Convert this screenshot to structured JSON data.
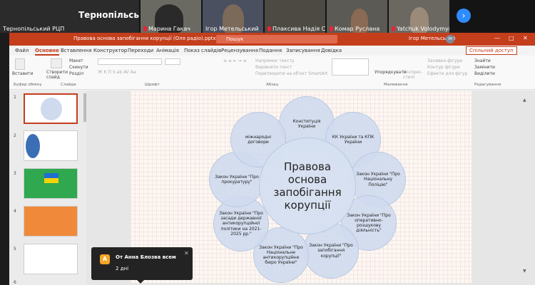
{
  "gallery": {
    "first_tile_name": "Тернопільський...",
    "tiles": [
      {
        "name": "Тернопільський РЦП",
        "muted": false
      },
      {
        "name": "Марина Гакач",
        "muted": true
      },
      {
        "name": "Ігор Метельський",
        "muted": false
      },
      {
        "name": "Плаксива Надія Степа...",
        "muted": true
      },
      {
        "name": "Комар Руслана",
        "muted": true
      },
      {
        "name": "Yatchuk Volodymyr",
        "muted": true
      }
    ],
    "next_icon": "chevron-right-icon"
  },
  "ppt": {
    "doc_title": "Правова основа запобігання корупції (Оля радіо).pptx  -  PowerPoint",
    "search_placeholder": "Пошук",
    "user_name": "Ігор Метельський",
    "user_initials": "ІМ",
    "tabs": [
      "Файл",
      "Основне",
      "Вставлення",
      "Конструктор",
      "Переходи",
      "Анімація",
      "Показ слайдів",
      "Рецензування",
      "Подання",
      "Записування",
      "Довідка"
    ],
    "share_label": "Спільний доступ",
    "ribbon": {
      "paste": "Вставити",
      "create_slide": "Створити слайд",
      "layout": "Макет",
      "reset": "Скинути",
      "section": "Розділ",
      "text_direction": "Напрямок тексту",
      "align_text": "Вирівняти текст",
      "smartart": "Перетворити на об'єкт SmartArt",
      "arrange": "Упорядкувати",
      "quick_styles": "Експрес-стилі",
      "fill": "Заливка фігури",
      "outline": "Контур фігури",
      "effects": "Ефекти для фігур",
      "find": "Знайти",
      "replace": "Замінити",
      "select": "Виділити",
      "groups": [
        "Буфер обміну",
        "Слайди",
        "Шрифт",
        "Абзац",
        "Малювання",
        "Редагування"
      ]
    },
    "slide_numbers": [
      "1",
      "2",
      "3",
      "4",
      "5",
      "6"
    ]
  },
  "slide": {
    "center": "Правова основа запобігання корупції",
    "petals": [
      "Конституція України",
      "КК України та КПК України",
      "Закон України \"Про Національну Поліцію\"",
      "Закон України \"Про оперативно-розшукову діяльність\"",
      "Закон України \"Про запобігання корупції\"",
      "Закон України \"Про Національне антикорупційне бюро України\"",
      "Закон України \"Про засади державної антикорупційної політики на 2021-2025 рр.\"",
      "Закон України \"Про прокуратуру\"",
      "міжнародні договори"
    ]
  },
  "toast": {
    "avatar_letter": "А",
    "from": "От Анна Блозва всем",
    "message": "2 дні"
  },
  "colors": {
    "ppt_accent": "#c43e1c",
    "zoom_blue": "#2d8cff",
    "petal_fill": "#cfdaee"
  }
}
